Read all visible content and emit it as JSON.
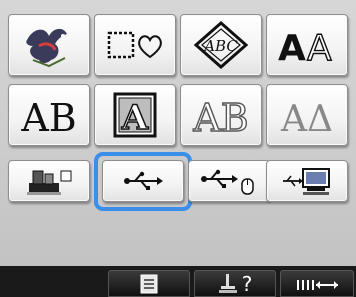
{
  "row1": [
    {
      "name": "bird-pattern-icon"
    },
    {
      "name": "frame-shapes-icon"
    },
    {
      "name": "monogram-abc-diamond-icon",
      "text": "ABC"
    },
    {
      "name": "font-aa-icon",
      "text": "AA"
    }
  ],
  "row2": [
    {
      "name": "font-ab-icon",
      "text": "AB"
    },
    {
      "name": "framed-a-icon",
      "text": "A"
    },
    {
      "name": "outline-ab-icon",
      "text": "AB"
    },
    {
      "name": "greek-alpha-delta-icon",
      "text": "ΑΔ"
    }
  ],
  "row3": [
    {
      "name": "embroidery-card-icon"
    },
    {
      "name": "usb-icon",
      "selected": true
    },
    {
      "name": "usb-mouse-icon"
    },
    {
      "name": "computer-icon"
    }
  ],
  "bottom": {
    "help_label": "?",
    "accent": "#3b8fe8"
  }
}
